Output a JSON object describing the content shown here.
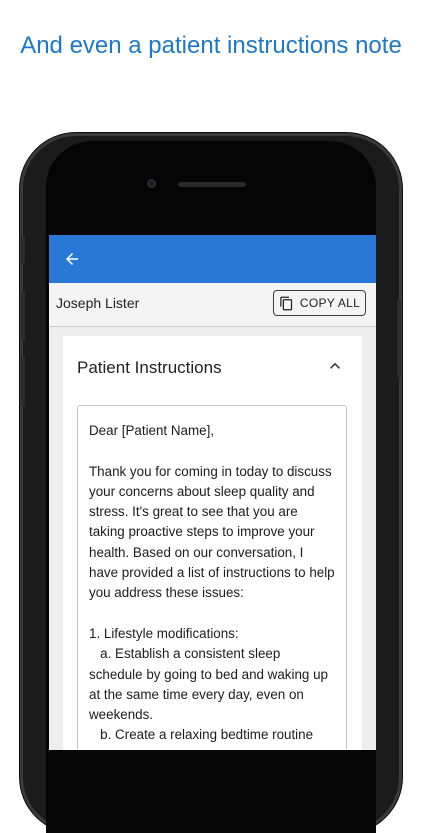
{
  "headline": "And even a patient instructions note",
  "app": {
    "patient_name": "Joseph Lister",
    "copy_all_label": "COPY ALL",
    "section_title": "Patient Instructions",
    "note_text": "Dear [Patient Name],\n\nThank you for coming in today to discuss your concerns about sleep quality and stress. It's great to see that you are taking proactive steps to improve your health. Based on our conversation, I have provided a list of instructions to help you address these issues:\n\n1. Lifestyle modifications:\n   a. Establish a consistent sleep schedule by going to bed and waking up at the same time every day, even on weekends.\n   b. Create a relaxing bedtime routine",
    "colors": {
      "app_bar": "#2a78d6",
      "headline": "#1e78c8"
    },
    "icons": {
      "back": "arrow-left-icon",
      "copy": "copy-icon",
      "collapse": "chevron-up-icon"
    }
  }
}
